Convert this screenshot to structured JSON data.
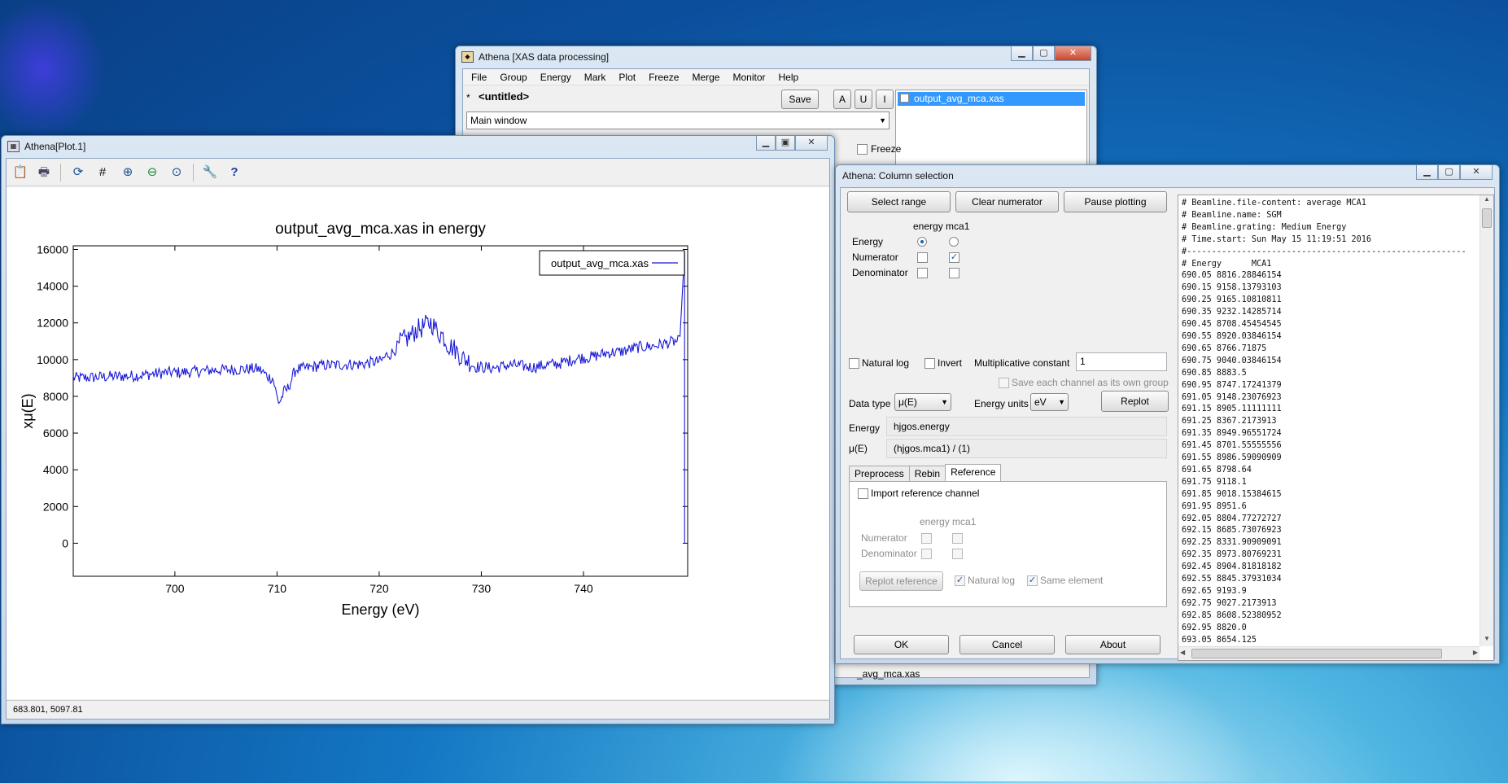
{
  "athena_main": {
    "title": "Athena [XAS data processing]",
    "menu": [
      "File",
      "Group",
      "Energy",
      "Mark",
      "Plot",
      "Freeze",
      "Merge",
      "Monitor",
      "Help"
    ],
    "project_marker": "*",
    "project_name": "<untitled>",
    "save_label": "Save",
    "btn_a": "A",
    "btn_u": "U",
    "btn_i": "I",
    "view_select": "Main window",
    "group_item": "output_avg_mca.xas",
    "freeze_label": "Freeze",
    "status_fragment": "_avg_mca.xas"
  },
  "plot_window": {
    "title": "Athena[Plot.1]",
    "status_coords": "683.801,  5097.81"
  },
  "chart_data": {
    "type": "line",
    "title": "output_avg_mca.xas in energy",
    "xlabel": "Energy    (eV)",
    "ylabel": "xμ(E)",
    "xlim": [
      690.05,
      750.2
    ],
    "ylim": [
      -1800,
      16200
    ],
    "xticks": [
      700,
      710,
      720,
      730,
      740
    ],
    "yticks": [
      0,
      2000,
      4000,
      6000,
      8000,
      10000,
      12000,
      14000,
      16000
    ],
    "legend_position": "top-right",
    "series": [
      {
        "name": "output_avg_mca.xas",
        "color": "#1a1ad8",
        "anchors_x": [
          690.05,
          695,
          700,
          705,
          708,
          709.5,
          710.2,
          710.8,
          712,
          715,
          718,
          720,
          721,
          722.5,
          724,
          725,
          726,
          727,
          728.5,
          729.5,
          731,
          733,
          735,
          737,
          740,
          743,
          746,
          749.5
        ],
        "anchors_y": [
          9000,
          9100,
          9300,
          9450,
          9500,
          9000,
          7700,
          8300,
          9500,
          9700,
          9750,
          9900,
          10300,
          11100,
          11700,
          12000,
          11400,
          10700,
          10000,
          9600,
          9550,
          9700,
          9600,
          9750,
          10100,
          10400,
          10700,
          11000
        ],
        "noise_amp": 320,
        "step": 0.1,
        "end_spike": {
          "x": 749.9,
          "ymin": 0,
          "ymax": 15900
        }
      }
    ]
  },
  "column_dialog": {
    "title": "Athena: Column selection",
    "select_range": "Select range",
    "clear_numerator": "Clear numerator",
    "pause_plotting": "Pause plotting",
    "column_header": "energy mca1",
    "row_energy": "Energy",
    "row_numerator": "Numerator",
    "row_denominator": "Denominator",
    "natural_log": "Natural log",
    "invert": "Invert",
    "mult_const_label": "Multiplicative constant",
    "mult_const_value": "1",
    "save_each": "Save each channel as its own group",
    "data_type_label": "Data type",
    "data_type_value": "μ(E)",
    "energy_units_label": "Energy units",
    "energy_units_value": "eV",
    "replot": "Replot",
    "energy_label": "Energy",
    "energy_expr": "hjgos.energy",
    "mu_label": "μ(E)",
    "mu_expr": "(hjgos.mca1) / (1)",
    "tabs": [
      "Preprocess",
      "Rebin",
      "Reference"
    ],
    "import_ref": "Import reference channel",
    "ref_column_header": "energy mca1",
    "ref_numerator": "Numerator",
    "ref_denominator": "Denominator",
    "replot_reference": "Replot reference",
    "ref_natural_log": "Natural log",
    "same_element": "Same element",
    "ok": "OK",
    "cancel": "Cancel",
    "about": "About",
    "file_lines": [
      "# Beamline.file-content: average MCA1",
      "# Beamline.name: SGM",
      "# Beamline.grating: Medium Energy",
      "# Time.start: Sun May 15 11:19:51 2016",
      "#--------------------------------------------------------",
      "# Energy      MCA1",
      "690.05 8816.28846154",
      "690.15 9158.13793103",
      "690.25 9165.10810811",
      "690.35 9232.14285714",
      "690.45 8708.45454545",
      "690.55 8920.03846154",
      "690.65 8766.71875",
      "690.75 9040.03846154",
      "690.85 8883.5",
      "690.95 8747.17241379",
      "691.05 9148.23076923",
      "691.15 8905.11111111",
      "691.25 8367.2173913",
      "691.35 8949.96551724",
      "691.45 8701.55555556",
      "691.55 8986.59090909",
      "691.65 8798.64",
      "691.75 9118.1",
      "691.85 9018.15384615",
      "691.95 8951.6",
      "692.05 8804.77272727",
      "692.15 8685.73076923",
      "692.25 8331.90909091",
      "692.35 8973.80769231",
      "692.45 8904.81818182",
      "692.55 8845.37931034",
      "692.65 9193.9",
      "692.75 9027.2173913",
      "692.85 8608.52380952",
      "692.95 8820.0",
      "693.05 8654.125"
    ]
  }
}
